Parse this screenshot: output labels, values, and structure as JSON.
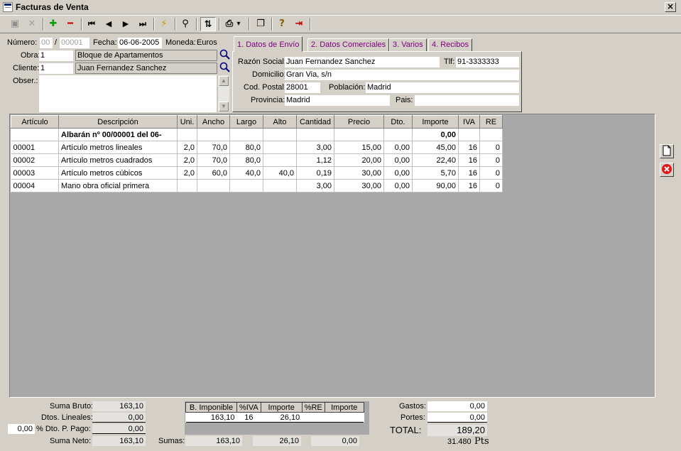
{
  "window": {
    "title": "Facturas de Venta",
    "close": "×"
  },
  "toolbar": {
    "buttons": [
      {
        "name": "save-icon",
        "glyph": "▣"
      },
      {
        "name": "cancel-icon",
        "glyph": "✕"
      },
      {
        "name": "add-icon",
        "glyph": "✚"
      },
      {
        "name": "remove-icon",
        "glyph": "━"
      },
      {
        "name": "first-record-icon",
        "glyph": "⏮"
      },
      {
        "name": "prev-record-icon",
        "glyph": "◀"
      },
      {
        "name": "next-record-icon",
        "glyph": "▶"
      },
      {
        "name": "last-record-icon",
        "glyph": "⏭"
      },
      {
        "name": "lightning-icon",
        "glyph": "⚡"
      },
      {
        "name": "binoculars-icon",
        "glyph": "⚲"
      },
      {
        "name": "sort-icon",
        "glyph": "⇅"
      },
      {
        "name": "print-icon",
        "glyph": "⎙"
      },
      {
        "name": "print-dropdown-icon",
        "glyph": "▾"
      },
      {
        "name": "copy-icon",
        "glyph": "❐"
      },
      {
        "name": "help-icon",
        "glyph": "?"
      },
      {
        "name": "exit-icon",
        "glyph": "⇥"
      }
    ]
  },
  "header": {
    "numero_label": "Número:",
    "numero_serie": "00",
    "numero_sep": "/",
    "numero_value": "00001",
    "fecha_label": "Fecha:",
    "fecha_value": "06-06-2005",
    "moneda_label": "Moneda:",
    "moneda_value": "Euros",
    "obra_label": "Obra:",
    "obra_code": "1",
    "obra_name": "Bloque de Apartamentos",
    "cliente_label": "Cliente:",
    "cliente_code": "1",
    "cliente_name": "Juan Fernandez Sanchez",
    "obser_label": "Obser.:",
    "obser_value": ""
  },
  "tabs": [
    {
      "label": "1. Datos de Envío"
    },
    {
      "label": "2. Datos Comerciales"
    },
    {
      "label": "3. Varios"
    },
    {
      "label": "4. Recibos"
    }
  ],
  "envio": {
    "razon_label": "Razón Social:",
    "razon_value": "Juan Fernandez Sanchez",
    "tlf_label": "Tlf:",
    "tlf_value": "91-3333333",
    "domicilio_label": "Domicilio:",
    "domicilio_value": "Gran Via, s/n",
    "cp_label": "Cod. Postal:",
    "cp_value": "28001",
    "poblacion_label": "Población:",
    "poblacion_value": "Madrid",
    "provincia_label": "Provincia:",
    "provincia_value": "Madrid",
    "pais_label": "Pais:",
    "pais_value": ""
  },
  "grid": {
    "columns": [
      "Artículo",
      "Descripción",
      "Uni.",
      "Ancho",
      "Largo",
      "Alto",
      "Cantidad",
      "Precio",
      "Dto.",
      "Importe",
      "IVA",
      "RE"
    ],
    "rows": [
      [
        "",
        "Albarán nº 00/00001  del 06-",
        "",
        "",
        "",
        "",
        "",
        "",
        "",
        "0,00",
        "",
        ""
      ],
      [
        "00001",
        "Artículo metros lineales",
        "2,0",
        "70,0",
        "80,0",
        "",
        "3,00",
        "15,00",
        "0,00",
        "45,00",
        "16",
        "0"
      ],
      [
        "00002",
        "Artículo metros cuadrados",
        "2,0",
        "70,0",
        "80,0",
        "",
        "1,12",
        "20,00",
        "0,00",
        "22,40",
        "16",
        "0"
      ],
      [
        "00003",
        "Artículo metros cúbicos",
        "2,0",
        "60,0",
        "40,0",
        "40,0",
        "0,19",
        "30,00",
        "0,00",
        "5,70",
        "16",
        "0"
      ],
      [
        "00004",
        "Mano obra oficial primera",
        "",
        "",
        "",
        "",
        "3,00",
        "30,00",
        "0,00",
        "90,00",
        "16",
        "0"
      ]
    ]
  },
  "totals": {
    "suma_bruto_label": "Suma Bruto:",
    "suma_bruto": "163,10",
    "dtos_lineales_label": "Dtos. Lineales:",
    "dtos_lineales": "0,00",
    "dto_pp_pct": "0,00",
    "dto_pp_label": "% Dto. P. Pago:",
    "dto_pp": "0,00",
    "suma_neto_label": "Suma Neto:",
    "suma_neto": "163,10",
    "iva_headers": [
      "B. Imponible",
      "%IVA",
      "Importe",
      "%RE",
      "Importe"
    ],
    "iva_row": [
      "163,10",
      "16",
      "26,10",
      "",
      ""
    ],
    "sumas_label": "Sumas:",
    "sumas_base": "163,10",
    "sumas_iva": "26,10",
    "sumas_re": "0,00",
    "gastos_label": "Gastos:",
    "gastos": "0,00",
    "portes_label": "Portes:",
    "portes": "0,00",
    "total_label": "TOTAL:",
    "total": "189,20",
    "total_pts": "31.480",
    "pts_label": "Pts"
  }
}
